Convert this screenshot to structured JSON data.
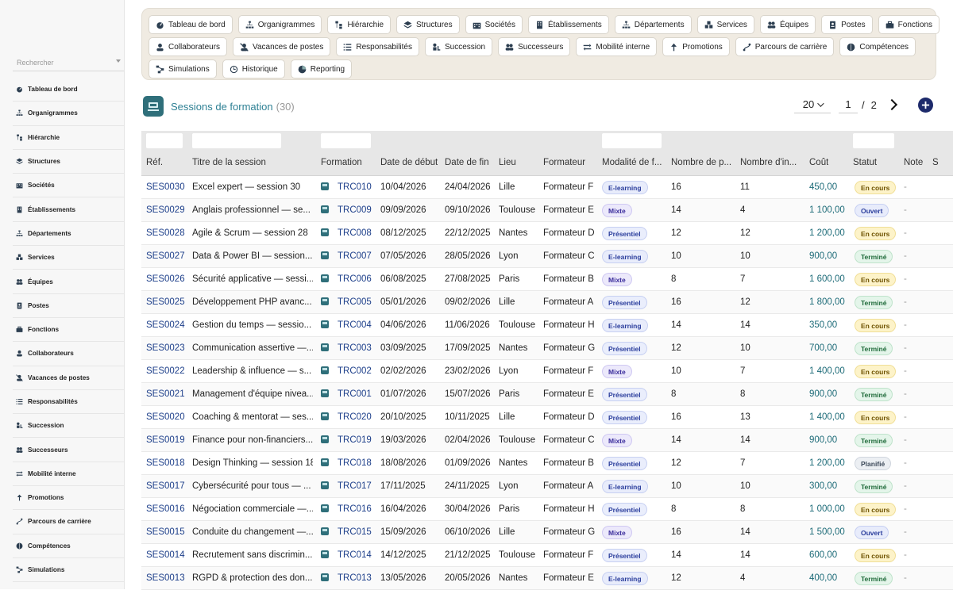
{
  "sidebar": {
    "search_placeholder": "Rechercher",
    "items": [
      {
        "label": "Tableau de bord",
        "icon": "gauge-icon"
      },
      {
        "label": "Organigrammes",
        "icon": "sitemap-icon"
      },
      {
        "label": "Hiérarchie",
        "icon": "hierarchy-icon"
      },
      {
        "label": "Structures",
        "icon": "layers-icon"
      },
      {
        "label": "Sociétés",
        "icon": "building-icon"
      },
      {
        "label": "Établissements",
        "icon": "office-icon"
      },
      {
        "label": "Départements",
        "icon": "sitemap-icon"
      },
      {
        "label": "Services",
        "icon": "cubes-icon"
      },
      {
        "label": "Équipes",
        "icon": "users-icon"
      },
      {
        "label": "Postes",
        "icon": "badge-icon"
      },
      {
        "label": "Fonctions",
        "icon": "briefcase-icon"
      },
      {
        "label": "Collaborateurs",
        "icon": "user-icon"
      },
      {
        "label": "Vacances de postes",
        "icon": "user-slash-icon"
      },
      {
        "label": "Responsabilités",
        "icon": "list-icon"
      },
      {
        "label": "Succession",
        "icon": "succession-icon"
      },
      {
        "label": "Successeurs",
        "icon": "users-icon"
      },
      {
        "label": "Mobilité interne",
        "icon": "exchange-icon"
      },
      {
        "label": "Promotions",
        "icon": "arrow-up-icon"
      },
      {
        "label": "Parcours de carrière",
        "icon": "route-icon"
      },
      {
        "label": "Compétences",
        "icon": "brain-icon"
      },
      {
        "label": "Simulations",
        "icon": "diagram-icon"
      }
    ]
  },
  "topnav": {
    "rows": [
      [
        {
          "label": "Tableau de bord",
          "icon": "gauge-icon"
        },
        {
          "label": "Organigrammes",
          "icon": "sitemap-icon"
        },
        {
          "label": "Hiérarchie",
          "icon": "hierarchy-icon"
        },
        {
          "label": "Structures",
          "icon": "layers-icon"
        },
        {
          "label": "Sociétés",
          "icon": "building-icon"
        },
        {
          "label": "Établissements",
          "icon": "office-icon"
        },
        {
          "label": "Départements",
          "icon": "sitemap-icon"
        },
        {
          "label": "Services",
          "icon": "cubes-icon"
        },
        {
          "label": "Équipes",
          "icon": "users-icon"
        },
        {
          "label": "Postes",
          "icon": "badge-icon"
        },
        {
          "label": "Fonctions",
          "icon": "briefcase-icon"
        }
      ],
      [
        {
          "label": "Collaborateurs",
          "icon": "user-icon"
        },
        {
          "label": "Vacances de postes",
          "icon": "user-slash-icon"
        },
        {
          "label": "Responsabilités",
          "icon": "list-icon"
        },
        {
          "label": "Succession",
          "icon": "succession-icon"
        },
        {
          "label": "Successeurs",
          "icon": "users-icon"
        },
        {
          "label": "Mobilité interne",
          "icon": "exchange-icon"
        },
        {
          "label": "Promotions",
          "icon": "arrow-up-icon"
        },
        {
          "label": "Parcours de carrière",
          "icon": "route-icon"
        },
        {
          "label": "Compétences",
          "icon": "brain-icon"
        }
      ],
      [
        {
          "label": "Simulations",
          "icon": "diagram-icon"
        },
        {
          "label": "Historique",
          "icon": "history-icon"
        },
        {
          "label": "Reporting",
          "icon": "pie-icon"
        }
      ]
    ]
  },
  "page": {
    "title": "Sessions de formation",
    "count": "(30)"
  },
  "pager": {
    "page_size": "20",
    "current_page": "1",
    "separator": "/",
    "total_pages": "2"
  },
  "table": {
    "columns": [
      "Réf.",
      "Titre de la session",
      "Formation",
      "Date de début",
      "Date de fin",
      "Lieu",
      "Formateur",
      "Modalité de f...",
      "Nombre de p...",
      "Nombre d'in...",
      "Coût",
      "Statut",
      "Note",
      "S"
    ],
    "rows": [
      {
        "ref": "SES0030",
        "title": "Excel expert — session 30",
        "formation": "TRC010",
        "start": "10/04/2026",
        "end": "24/04/2026",
        "place": "Lille",
        "trainer": "Formateur F",
        "mode": "E-learning",
        "places": "16",
        "enrolled": "11",
        "cost": "450,00",
        "status": "En cours",
        "note": "-"
      },
      {
        "ref": "SES0029",
        "title": "Anglais professionnel — se...",
        "formation": "TRC009",
        "start": "09/09/2026",
        "end": "09/10/2026",
        "place": "Toulouse",
        "trainer": "Formateur E",
        "mode": "Mixte",
        "places": "14",
        "enrolled": "4",
        "cost": "1 100,00",
        "status": "Ouvert",
        "note": "-"
      },
      {
        "ref": "SES0028",
        "title": "Agile & Scrum — session 28",
        "formation": "TRC008",
        "start": "08/12/2025",
        "end": "22/12/2025",
        "place": "Nantes",
        "trainer": "Formateur D",
        "mode": "Présentiel",
        "places": "12",
        "enrolled": "12",
        "cost": "1 200,00",
        "status": "En cours",
        "note": "-"
      },
      {
        "ref": "SES0027",
        "title": "Data & Power BI — session...",
        "formation": "TRC007",
        "start": "07/05/2026",
        "end": "28/05/2026",
        "place": "Lyon",
        "trainer": "Formateur C",
        "mode": "E-learning",
        "places": "10",
        "enrolled": "10",
        "cost": "900,00",
        "status": "Terminé",
        "note": "-"
      },
      {
        "ref": "SES0026",
        "title": "Sécurité applicative — sessi...",
        "formation": "TRC006",
        "start": "06/08/2025",
        "end": "27/08/2025",
        "place": "Paris",
        "trainer": "Formateur B",
        "mode": "Mixte",
        "places": "8",
        "enrolled": "7",
        "cost": "1 600,00",
        "status": "En cours",
        "note": "-"
      },
      {
        "ref": "SES0025",
        "title": "Développement PHP avanc...",
        "formation": "TRC005",
        "start": "05/01/2026",
        "end": "09/02/2026",
        "place": "Lille",
        "trainer": "Formateur A",
        "mode": "Présentiel",
        "places": "16",
        "enrolled": "12",
        "cost": "1 800,00",
        "status": "Terminé",
        "note": "-"
      },
      {
        "ref": "SES0024",
        "title": "Gestion du temps — sessio...",
        "formation": "TRC004",
        "start": "04/06/2026",
        "end": "11/06/2026",
        "place": "Toulouse",
        "trainer": "Formateur H",
        "mode": "E-learning",
        "places": "14",
        "enrolled": "14",
        "cost": "350,00",
        "status": "En cours",
        "note": "-"
      },
      {
        "ref": "SES0023",
        "title": "Communication assertive —...",
        "formation": "TRC003",
        "start": "03/09/2025",
        "end": "17/09/2025",
        "place": "Nantes",
        "trainer": "Formateur G",
        "mode": "Présentiel",
        "places": "12",
        "enrolled": "10",
        "cost": "700,00",
        "status": "Terminé",
        "note": "-"
      },
      {
        "ref": "SES0022",
        "title": "Leadership & influence — s...",
        "formation": "TRC002",
        "start": "02/02/2026",
        "end": "23/02/2026",
        "place": "Lyon",
        "trainer": "Formateur F",
        "mode": "Mixte",
        "places": "10",
        "enrolled": "7",
        "cost": "1 400,00",
        "status": "En cours",
        "note": "-"
      },
      {
        "ref": "SES0021",
        "title": "Management d'équipe nivea...",
        "formation": "TRC001",
        "start": "01/07/2026",
        "end": "15/07/2026",
        "place": "Paris",
        "trainer": "Formateur E",
        "mode": "Présentiel",
        "places": "8",
        "enrolled": "8",
        "cost": "900,00",
        "status": "Terminé",
        "note": "-"
      },
      {
        "ref": "SES0020",
        "title": "Coaching & mentorat — ses...",
        "formation": "TRC020",
        "start": "20/10/2025",
        "end": "10/11/2025",
        "place": "Lille",
        "trainer": "Formateur D",
        "mode": "Présentiel",
        "places": "16",
        "enrolled": "13",
        "cost": "1 400,00",
        "status": "En cours",
        "note": "-"
      },
      {
        "ref": "SES0019",
        "title": "Finance pour non-financiers...",
        "formation": "TRC019",
        "start": "19/03/2026",
        "end": "02/04/2026",
        "place": "Toulouse",
        "trainer": "Formateur C",
        "mode": "Mixte",
        "places": "14",
        "enrolled": "14",
        "cost": "900,00",
        "status": "Terminé",
        "note": "-"
      },
      {
        "ref": "SES0018",
        "title": "Design Thinking — session 18",
        "formation": "TRC018",
        "start": "18/08/2026",
        "end": "01/09/2026",
        "place": "Nantes",
        "trainer": "Formateur B",
        "mode": "Présentiel",
        "places": "12",
        "enrolled": "7",
        "cost": "1 200,00",
        "status": "Planifié",
        "note": "-"
      },
      {
        "ref": "SES0017",
        "title": "Cybersécurité pour tous — ...",
        "formation": "TRC017",
        "start": "17/11/2025",
        "end": "24/11/2025",
        "place": "Lyon",
        "trainer": "Formateur A",
        "mode": "E-learning",
        "places": "10",
        "enrolled": "10",
        "cost": "300,00",
        "status": "Terminé",
        "note": "-"
      },
      {
        "ref": "SES0016",
        "title": "Négociation commerciale —...",
        "formation": "TRC016",
        "start": "16/04/2026",
        "end": "30/04/2026",
        "place": "Paris",
        "trainer": "Formateur H",
        "mode": "Présentiel",
        "places": "8",
        "enrolled": "8",
        "cost": "1 000,00",
        "status": "En cours",
        "note": "-"
      },
      {
        "ref": "SES0015",
        "title": "Conduite du changement —...",
        "formation": "TRC015",
        "start": "15/09/2026",
        "end": "06/10/2026",
        "place": "Lille",
        "trainer": "Formateur G",
        "mode": "Mixte",
        "places": "16",
        "enrolled": "14",
        "cost": "1 500,00",
        "status": "Ouvert",
        "note": "-"
      },
      {
        "ref": "SES0014",
        "title": "Recrutement sans discrimin...",
        "formation": "TRC014",
        "start": "14/12/2025",
        "end": "21/12/2025",
        "place": "Toulouse",
        "trainer": "Formateur F",
        "mode": "Présentiel",
        "places": "14",
        "enrolled": "14",
        "cost": "600,00",
        "status": "En cours",
        "note": "-"
      },
      {
        "ref": "SES0013",
        "title": "RGPD & protection des don...",
        "formation": "TRC013",
        "start": "13/05/2026",
        "end": "20/05/2026",
        "place": "Nantes",
        "trainer": "Formateur E",
        "mode": "E-learning",
        "places": "12",
        "enrolled": "4",
        "cost": "400,00",
        "status": "Terminé",
        "note": "-"
      }
    ]
  }
}
